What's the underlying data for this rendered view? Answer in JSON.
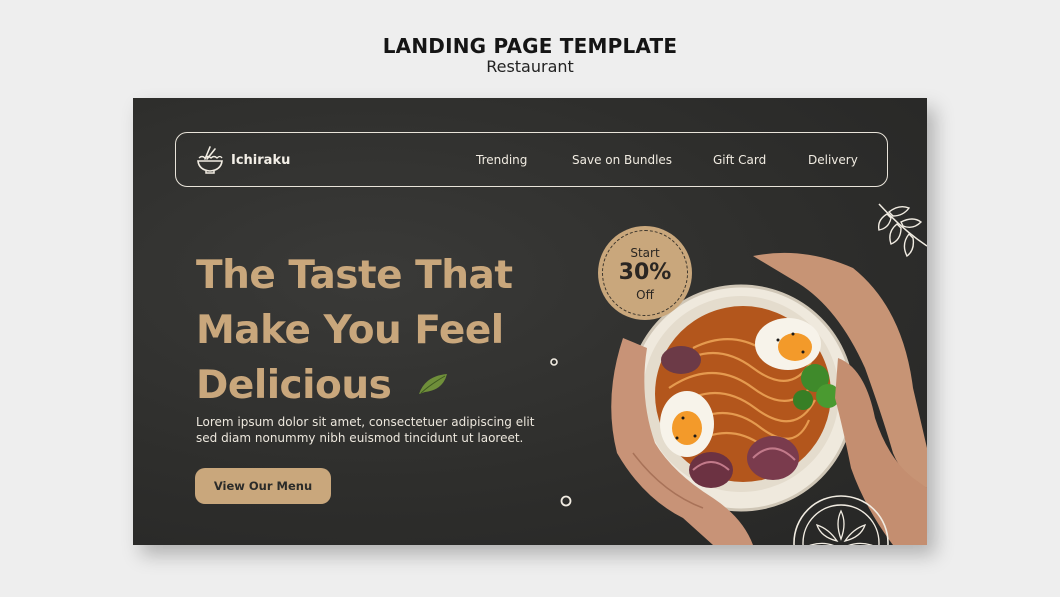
{
  "header": {
    "title": "LANDING PAGE TEMPLATE",
    "subtitle": "Restaurant"
  },
  "brand": {
    "name": "Ichiraku",
    "icon": "ramen-bowl-icon"
  },
  "nav": {
    "items": [
      {
        "label": "Trending"
      },
      {
        "label": "Save on Bundles"
      },
      {
        "label": "Gift Card"
      },
      {
        "label": "Delivery"
      }
    ]
  },
  "hero": {
    "headline_lines": [
      "The Taste That",
      "Make You Feel",
      "Delicious"
    ],
    "body_lines": [
      "Lorem ipsum dolor sit amet, consectetuer adipiscing elit",
      "sed diam nonummy nibh euismod tincidunt ut laoreet."
    ],
    "cta_label": "View Our Menu"
  },
  "badge": {
    "start": "Start",
    "percent": "30%",
    "off": "Off"
  },
  "colors": {
    "accent": "#c9a77c",
    "background_dark": "#2e2e2c",
    "text_light": "#f1ece2"
  }
}
